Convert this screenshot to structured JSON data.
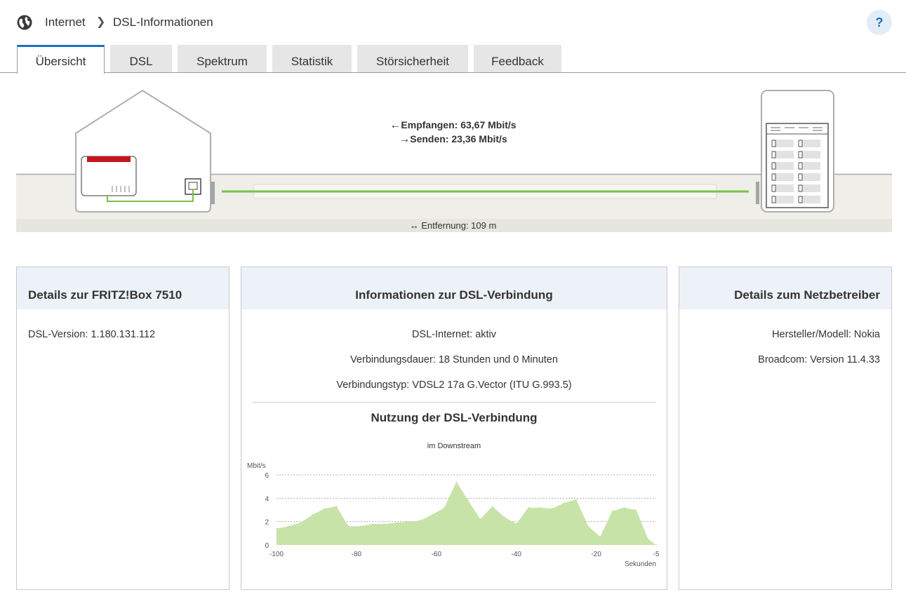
{
  "header": {
    "breadcrumb": [
      "Internet",
      "DSL-Informationen"
    ],
    "help_label": "?"
  },
  "tabs": [
    {
      "label": "Übersicht",
      "active": true
    },
    {
      "label": "DSL",
      "active": false
    },
    {
      "label": "Spektrum",
      "active": false
    },
    {
      "label": "Statistik",
      "active": false
    },
    {
      "label": "Störsicherheit",
      "active": false
    },
    {
      "label": "Feedback",
      "active": false
    }
  ],
  "diagram": {
    "receive": "Empfangen: 63,67 Mbit/s",
    "send": "Senden: 23,36 Mbit/s",
    "distance": "Entfernung: 109 m",
    "line_color": "#7ac143",
    "router_accent": "#c4161c"
  },
  "box_fritzbox": {
    "title": "Details zur FRITZ!Box 7510",
    "lines": [
      "DSL-Version: 1.180.131.112"
    ]
  },
  "box_dsl": {
    "title": "Informationen zur DSL-Verbindung",
    "lines": [
      "DSL-Internet: aktiv",
      "Verbindungsdauer: 18 Stunden und 0 Minuten",
      "Verbindungstyp: VDSL2 17a G.Vector (ITU G.993.5)"
    ],
    "usage_title": "Nutzung der DSL-Verbindung",
    "usage_subtitle": "im Downstream"
  },
  "box_provider": {
    "title": "Details zum Netzbetreiber",
    "lines": [
      "Hersteller/Modell: Nokia",
      "Broadcom: Version 11.4.33"
    ]
  },
  "chart_data": {
    "type": "area",
    "title": "im Downstream",
    "ylabel": "Mbit/s",
    "xlabel": "Sekunden",
    "ylim": [
      0,
      6
    ],
    "yticks": [
      0,
      2,
      4,
      6
    ],
    "xlim": [
      -100,
      -5
    ],
    "xticks": [
      -100,
      -80,
      -60,
      -40,
      -20,
      -5
    ],
    "grid": true,
    "fill_color": "#c8e3a8",
    "series": [
      {
        "x": [
          -100,
          -97,
          -94,
          -91,
          -88,
          -85,
          -82,
          -79,
          -76,
          -73,
          -70,
          -67,
          -64,
          -61,
          -58,
          -55,
          -52,
          -49,
          -46,
          -43,
          -40,
          -37,
          -34,
          -31,
          -28,
          -25,
          -22,
          -19,
          -16,
          -13,
          -10,
          -7,
          -5
        ],
        "values": [
          1.4,
          1.6,
          1.9,
          2.6,
          3.1,
          3.3,
          1.6,
          1.6,
          1.8,
          1.8,
          1.9,
          2.0,
          2.1,
          2.6,
          3.2,
          5.4,
          3.8,
          2.2,
          3.3,
          2.4,
          1.8,
          3.2,
          3.2,
          3.1,
          3.6,
          3.9,
          1.6,
          0.7,
          2.9,
          3.2,
          3.0,
          0.5,
          0.0
        ]
      }
    ]
  }
}
